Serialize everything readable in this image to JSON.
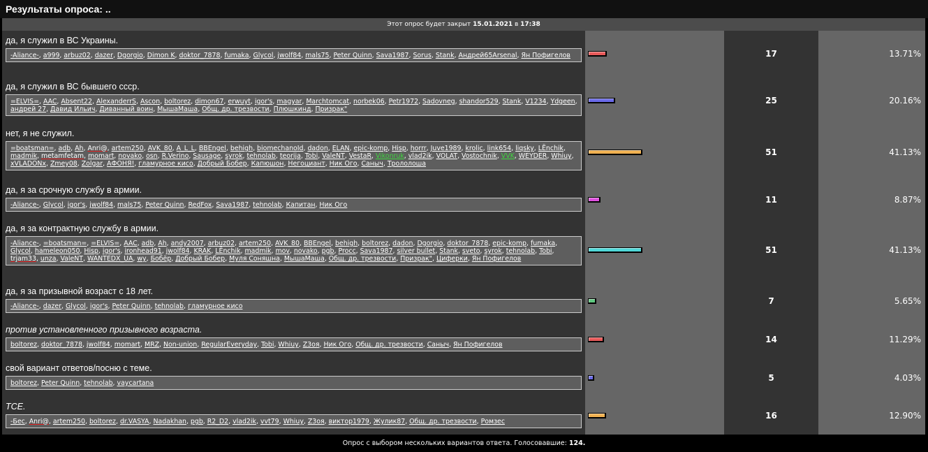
{
  "title": "Результаты опроса: ..",
  "closing": {
    "prefix": "Этот опрос будет закрыт",
    "date": "15.01.2021",
    "in": "в",
    "time": "17:38"
  },
  "footer": {
    "text": "Опрос с выбором нескольких вариантов ответа. Голосовавшие:",
    "total": "124."
  },
  "options": [
    {
      "question": "да, я служил в ВС Украины.",
      "italic": false,
      "count": "17",
      "percent": "13.71%",
      "pct": 13.71,
      "color": "#e85a5a",
      "h": 66,
      "voters": [
        "-Aliance-",
        "a999",
        "arbuz02",
        "dazer",
        "Dgorgio",
        "Dimon K",
        "doktor_7878",
        "fumaka",
        "Glycol",
        "jwolf84",
        "mals75",
        "Peter Quinn",
        "Sava1987",
        "Sorus",
        "Stank",
        "Андрей65Arsenal",
        "Ян Пофигелов"
      ]
    },
    {
      "question": "да, я служил в ВС бывшего ссср.",
      "italic": false,
      "count": "25",
      "percent": "20.16%",
      "pct": 20.16,
      "color": "#6a6ae8",
      "h": 67,
      "voters": [
        "=ELVIS=",
        "AAC",
        "Absent22",
        "AlexanderrS",
        "Ascon",
        "boltorez",
        "dimon67",
        "erwuyt",
        "igor's",
        "magyar",
        "Marchtomcat",
        "norbek06",
        "Petr1972",
        "Sadovneg",
        "shandor529",
        "Stank",
        "V1234",
        "Ydgeen",
        "андрей 27",
        "Давид Ильич",
        "Диванный воин",
        "МышаМаша",
        "Общ. др. трезвости",
        "Плюшкинд",
        "Призрак\""
      ]
    },
    {
      "question": "нет, я не служил.",
      "italic": false,
      "count": "51",
      "percent": "41.13%",
      "pct": 41.13,
      "color": "#f0b050",
      "h": 81,
      "voters": [
        "=boatsman=",
        "adb",
        "Ah",
        "Anri@|red",
        "artem250",
        "AVK_80",
        "A_L_L",
        "BBEngel",
        "behigh",
        "biomechanoId",
        "dadon",
        "ELAN",
        "epic-komp",
        "Hisp",
        "horrr",
        "Juve1989",
        "krolic",
        "link654",
        "liqsky",
        "LЁnchik",
        "madmik",
        "metamfetam|red",
        "momart",
        "novako",
        "osn",
        "R.Verino",
        "Sausage",
        "syrok",
        "tehnolab",
        "teorija",
        "Tobi",
        "ValeNT",
        "VestaR",
        "Vikonruk|green",
        "vlad2ik",
        "VOLAT",
        "Vostochnik",
        "VVK|green",
        "WEYDER",
        "Whiuy",
        "xVLADONx",
        "Zmey08",
        "Zolgar",
        "АФОНЯ!",
        "гламурное кисо",
        "Добрый Бобер",
        "Капюшон",
        "Негоциант",
        "Ник Ого",
        "Саныч",
        "Трололоша"
      ]
    },
    {
      "question": "да, я за срочную службу в армии.",
      "italic": false,
      "count": "11",
      "percent": "8.87%",
      "pct": 8.87,
      "color": "#e050e0",
      "h": 55,
      "voters": [
        "-Aliance-",
        "Glycol",
        "igor's",
        "jwolf84",
        "mals75",
        "Peter Quinn",
        "RedFox",
        "Sava1987",
        "tehnolab",
        "Капитан",
        "Ник Ого"
      ]
    },
    {
      "question": "да, я за контрактную службу в армии.",
      "italic": false,
      "count": "51",
      "percent": "41.13%",
      "pct": 41.13,
      "color": "#50d8d8",
      "h": 90,
      "voters": [
        "-Aliance-",
        "=boatsman=",
        "=ELVIS=",
        "AAC",
        "adb",
        "Ah",
        "andy2007",
        "arbuz02",
        "artem250",
        "AVK_80",
        "BBEngel",
        "behigh",
        "boltorez",
        "dadon",
        "Dgorgio",
        "doktor_7878",
        "epic-komp",
        "fumaka",
        "Glycol",
        "hameleon050",
        "Hisp",
        "igor's",
        "ironhead91",
        "jwolf84",
        "KRAK",
        "LЁnchik",
        "madmik",
        "mov",
        "novako",
        "pgb",
        "Procc",
        "Sava1987",
        "silver bullet",
        "Stank",
        "sveto",
        "syrok",
        "tehnolab",
        "Tobi",
        "trjam33|red",
        "unza",
        "ValeNT",
        "WANTEDX_UA",
        "wy",
        "Бобёр",
        "Добрый Бобер",
        "Муля Соняшна",
        "МышаМаша",
        "Общ. др. трезвости",
        "Призрак\"",
        "Циферки",
        "Ян Пофигелов"
      ]
    },
    {
      "question": "да, я за призывной возраст с 18 лет.",
      "italic": false,
      "count": "7",
      "percent": "5.65%",
      "pct": 5.65,
      "color": "#60c880",
      "h": 55,
      "voters": [
        "-Aliance-",
        "dazer",
        "Glycol",
        "igor's",
        "Peter Quinn",
        "tehnolab",
        "гламурное кисо"
      ]
    },
    {
      "question": "против установленного призывного возраста.",
      "italic": true,
      "count": "14",
      "percent": "11.29%",
      "pct": 11.29,
      "color": "#e85a5a",
      "h": 55,
      "voters": [
        "boltorez",
        "doktor_7878",
        "jwolf84",
        "momart",
        "MRZ",
        "Non-union",
        "RegularEveryday",
        "Tobi",
        "Whiuy",
        "Z3оя",
        "Ник Ого",
        "Общ. др. трезвости",
        "Саныч",
        "Ян Пофигелов"
      ]
    },
    {
      "question": "свой вариант ответов/посню с теме.",
      "italic": false,
      "count": "5",
      "percent": "4.03%",
      "pct": 4.03,
      "color": "#6a6ae8",
      "h": 55,
      "voters": [
        "boltorez",
        "Peter Quinn",
        "tehnolab",
        "vaycartana"
      ]
    },
    {
      "question": "TCE.",
      "italic": true,
      "count": "16",
      "percent": "12.90%",
      "pct": 12.9,
      "color": "#f0b050",
      "h": 54,
      "voters": [
        "-Бес",
        "Anri@|red",
        "artem250",
        "boltorez",
        "dr.VASYA",
        "Nadakhan",
        "pgb",
        "R2_D2",
        "vlad2ik",
        "vvt79",
        "Whiuy",
        "Z3оя",
        "виктор1979",
        "Жулик87",
        "Общ. др. трезвости",
        "Ромзес"
      ]
    }
  ]
}
